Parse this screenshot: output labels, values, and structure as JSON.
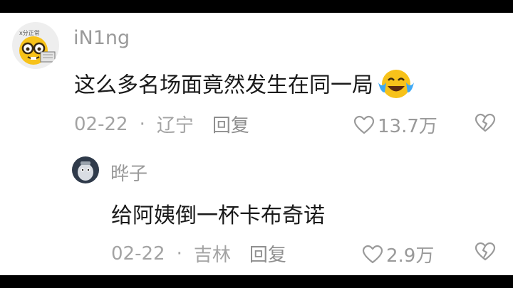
{
  "comments": [
    {
      "username": "iN1ng",
      "avatar_icon": "nerd-face-icon",
      "avatar_badge": "x分正常",
      "text": "这么多名场面竟然发生在同一局",
      "emoji": "crying-laughing-emoji",
      "date": "02-22",
      "separator": "·",
      "location": "辽宁",
      "reply_label": "回复",
      "likes": "13.7万"
    },
    {
      "username": "晔子",
      "avatar_icon": "cartoon-character-icon",
      "text": "给阿姨倒一杯卡布奇诺",
      "date": "02-22",
      "separator": "·",
      "location": "吉林",
      "reply_label": "回复",
      "likes": "2.9万"
    }
  ],
  "colors": {
    "background": "#ffffff",
    "letterbox": "#000000",
    "username": "#9a9a9a",
    "text": "#1a1a1a",
    "meta": "#a3a3a3"
  }
}
